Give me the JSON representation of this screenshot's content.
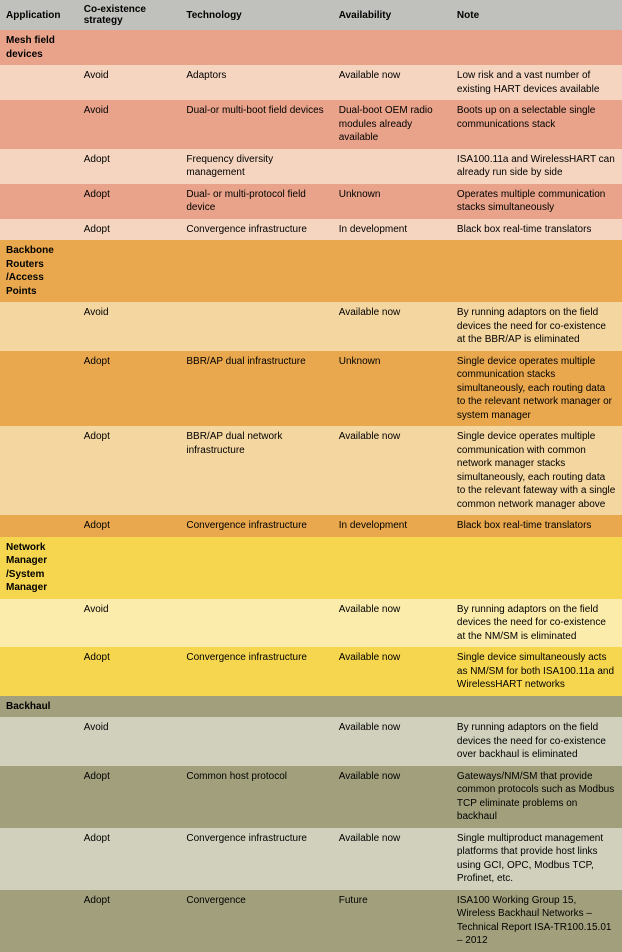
{
  "headers": [
    "Application",
    "Co-existence strategy",
    "Technology",
    "Availability",
    "Note"
  ],
  "sections": [
    {
      "title": "Mesh field devices",
      "bg": "#e9a38a",
      "rows": [
        {
          "bg": "#f5d5bf",
          "strategy": "Avoid",
          "tech": "Adaptors",
          "avail": "Available now",
          "note": "Low risk and a vast number of existing HART devices available"
        },
        {
          "bg": "#e9a38a",
          "strategy": "Avoid",
          "tech": "Dual-or multi-boot field devices",
          "avail": "Dual-boot OEM radio modules already available",
          "note": "Boots up on a selectable single communications stack"
        },
        {
          "bg": "#f5d5bf",
          "strategy": "Adopt",
          "tech": "Frequency diversity management",
          "avail": "",
          "note": "ISA100.11a and WirelessHART can already run side by side"
        },
        {
          "bg": "#e9a38a",
          "strategy": "Adopt",
          "tech": "Dual- or multi-protocol field device",
          "avail": "Unknown",
          "note": "Operates multiple communication stacks simultaneously"
        },
        {
          "bg": "#f5d5bf",
          "strategy": "Adopt",
          "tech": "Convergence infrastructure",
          "avail": "In development",
          "note": "Black box real-time translators"
        }
      ]
    },
    {
      "title": "Backbone Routers /Access Points",
      "bg": "#e9a84e",
      "rows": [
        {
          "bg": "#f4d6a0",
          "strategy": "Avoid",
          "tech": "",
          "avail": "Available now",
          "note": "By running adaptors on the field devices the need for co-existence at the BBR/AP is eliminated"
        },
        {
          "bg": "#e9a84e",
          "strategy": "Adopt",
          "tech": "BBR/AP dual infrastructure",
          "avail": "Unknown",
          "note": "Single device operates multiple communication stacks simultaneously, each routing data to the relevant network manager or system manager"
        },
        {
          "bg": "#f4d6a0",
          "strategy": "Adopt",
          "tech": "BBR/AP dual network infrastructure",
          "avail": "Available now",
          "note": "Single device operates multiple communication with common network manager stacks simultaneously, each routing data to the relevant fateway with a single common network manager above"
        },
        {
          "bg": "#e9a84e",
          "strategy": "Adopt",
          "tech": "Convergence infrastructure",
          "avail": "In development",
          "note": "Black box real-time translators"
        }
      ]
    },
    {
      "title": "Network Manager /System Manager",
      "bg": "#f6d64f",
      "rows": [
        {
          "bg": "#fbecab",
          "strategy": "Avoid",
          "tech": "",
          "avail": "Available now",
          "note": "By running adaptors on the field devices the need for co-existence at the NM/SM is eliminated"
        },
        {
          "bg": "#f6d64f",
          "strategy": "Adopt",
          "tech": "Convergence infrastructure",
          "avail": "Available now",
          "note": "Single device simultaneously acts as NM/SM for both ISA100.11a and WirelessHART networks"
        }
      ]
    },
    {
      "title": "Backhaul",
      "bg": "#a2a07c",
      "rows": [
        {
          "bg": "#d0d0bc",
          "strategy": "Avoid",
          "tech": "",
          "avail": "Available now",
          "note": "By running adaptors on the field devices the need for co-existence over backhaul is eliminated"
        },
        {
          "bg": "#a2a07c",
          "strategy": "Adopt",
          "tech": "Common host protocol",
          "avail": "Available now",
          "note": "Gateways/NM/SM that provide common protocols such as Modbus TCP eliminate problems on backhaul"
        },
        {
          "bg": "#d0d0bc",
          "strategy": "Adopt",
          "tech": "Convergence infrastructure",
          "avail": "Available now",
          "note": "Single multiproduct management platforms that provide host links using GCI, OPC, Modbus TCP, Profinet, etc."
        },
        {
          "bg": "#a2a07c",
          "strategy": "Adopt",
          "tech": "Convergence",
          "avail": "Future",
          "note": "ISA100 Working Group 15, Wireless Backhaul Networks – Technical Report ISA-TR100.15.01 – 2012"
        }
      ]
    }
  ]
}
